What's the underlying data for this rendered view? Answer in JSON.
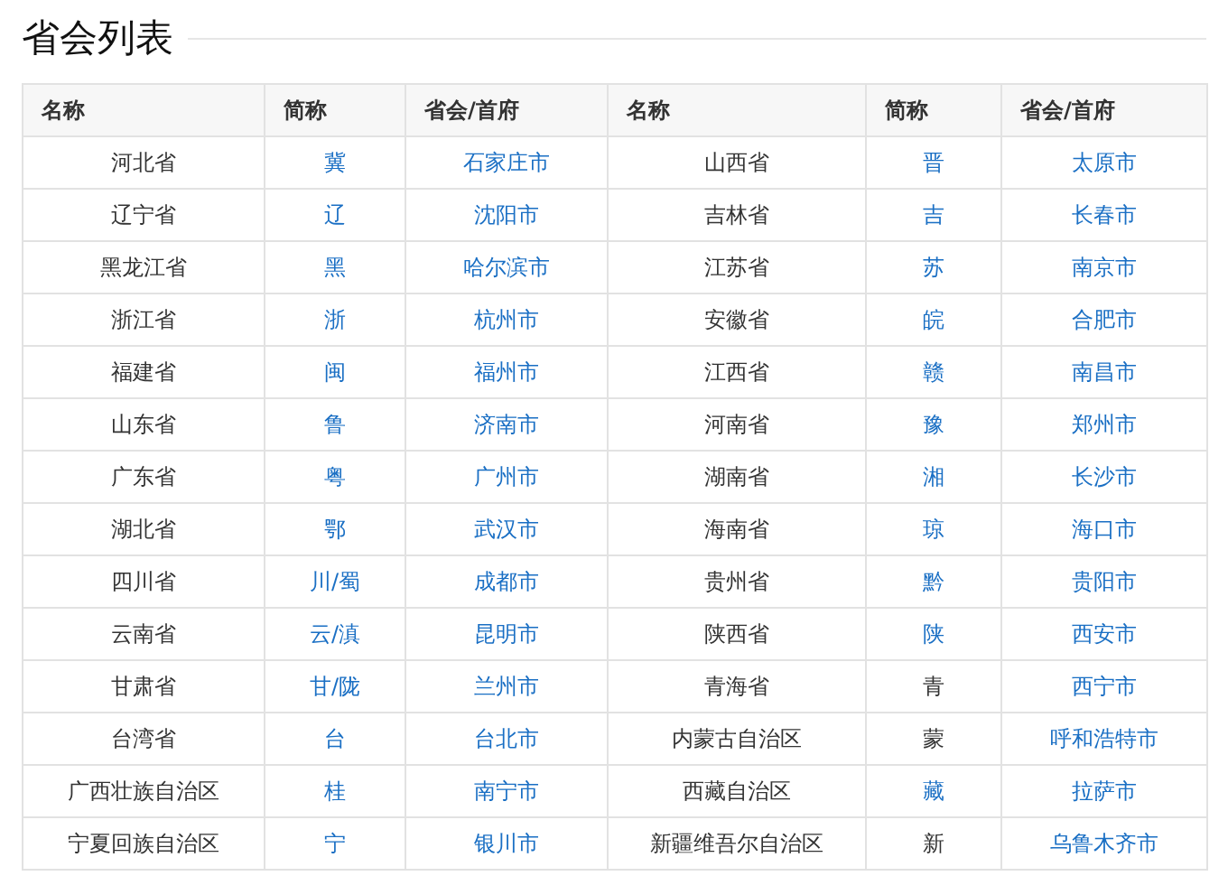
{
  "title": "省会列表",
  "table": {
    "columns": [
      "名称",
      "简称",
      "省会/首府",
      "名称",
      "简称",
      "省会/首府"
    ],
    "rows": [
      [
        {
          "name": "河北省",
          "abbr": {
            "text": "冀",
            "kind": "link"
          },
          "capital": "石家庄市"
        },
        {
          "name": "山西省",
          "abbr": {
            "text": "晋",
            "kind": "link"
          },
          "capital": "太原市"
        }
      ],
      [
        {
          "name": "辽宁省",
          "abbr": {
            "text": "辽",
            "kind": "link"
          },
          "capital": "沈阳市"
        },
        {
          "name": "吉林省",
          "abbr": {
            "text": "吉",
            "kind": "link"
          },
          "capital": "长春市"
        }
      ],
      [
        {
          "name": "黑龙江省",
          "abbr": {
            "text": "黑",
            "kind": "link"
          },
          "capital": "哈尔滨市"
        },
        {
          "name": "江苏省",
          "abbr": {
            "text": "苏",
            "kind": "link"
          },
          "capital": "南京市"
        }
      ],
      [
        {
          "name": "浙江省",
          "abbr": {
            "text": "浙",
            "kind": "link"
          },
          "capital": "杭州市"
        },
        {
          "name": "安徽省",
          "abbr": {
            "text": "皖",
            "kind": "link"
          },
          "capital": "合肥市"
        }
      ],
      [
        {
          "name": "福建省",
          "abbr": {
            "text": "闽",
            "kind": "link"
          },
          "capital": "福州市"
        },
        {
          "name": "江西省",
          "abbr": {
            "text": "赣",
            "kind": "link"
          },
          "capital": "南昌市"
        }
      ],
      [
        {
          "name": "山东省",
          "abbr": {
            "text": "鲁",
            "kind": "link"
          },
          "capital": "济南市"
        },
        {
          "name": "河南省",
          "abbr": {
            "text": "豫",
            "kind": "link"
          },
          "capital": "郑州市"
        }
      ],
      [
        {
          "name": "广东省",
          "abbr": {
            "text": "粤",
            "kind": "link"
          },
          "capital": "广州市"
        },
        {
          "name": "湖南省",
          "abbr": {
            "text": "湘",
            "kind": "link"
          },
          "capital": "长沙市"
        }
      ],
      [
        {
          "name": "湖北省",
          "abbr": {
            "text": "鄂",
            "kind": "link"
          },
          "capital": "武汉市"
        },
        {
          "name": "海南省",
          "abbr": {
            "text": "琼",
            "kind": "link"
          },
          "capital": "海口市"
        }
      ],
      [
        {
          "name": "四川省",
          "abbr": {
            "text": "川/蜀",
            "kind": "link"
          },
          "capital": "成都市"
        },
        {
          "name": "贵州省",
          "abbr": {
            "text": "黔",
            "kind": "link"
          },
          "capital": "贵阳市"
        }
      ],
      [
        {
          "name": "云南省",
          "abbr": {
            "text": "云/滇",
            "kind": "link"
          },
          "capital": "昆明市"
        },
        {
          "name": "陕西省",
          "abbr": {
            "text": "陕",
            "kind": "link"
          },
          "capital": "西安市"
        }
      ],
      [
        {
          "name": "甘肃省",
          "abbr": {
            "text": "甘/陇",
            "kind": "link"
          },
          "capital": "兰州市"
        },
        {
          "name": "青海省",
          "abbr": {
            "text": "青",
            "kind": "text"
          },
          "capital": "西宁市"
        }
      ],
      [
        {
          "name": "台湾省",
          "abbr": {
            "text": "台",
            "kind": "link"
          },
          "capital": "台北市"
        },
        {
          "name": "内蒙古自治区",
          "abbr": {
            "text": "蒙",
            "kind": "text"
          },
          "capital": "呼和浩特市"
        }
      ],
      [
        {
          "name": "广西壮族自治区",
          "abbr": {
            "text": "桂",
            "kind": "link"
          },
          "capital": "南宁市"
        },
        {
          "name": "西藏自治区",
          "abbr": {
            "text": "藏",
            "kind": "link"
          },
          "capital": "拉萨市"
        }
      ],
      [
        {
          "name": "宁夏回族自治区",
          "abbr": {
            "text": "宁",
            "kind": "link"
          },
          "capital": "银川市"
        },
        {
          "name": "新疆维吾尔自治区",
          "abbr": {
            "text": "新",
            "kind": "text"
          },
          "capital": "乌鲁木齐市"
        }
      ]
    ]
  }
}
